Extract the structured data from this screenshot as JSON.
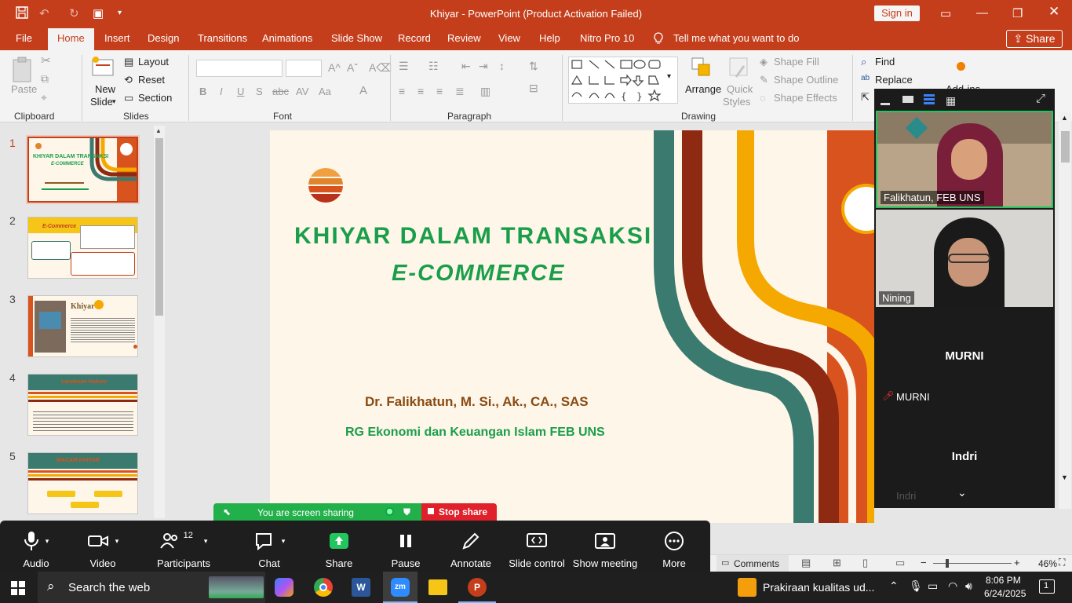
{
  "titlebar": {
    "title": "Khiyar  -  PowerPoint (Product Activation Failed)",
    "signin": "Sign in"
  },
  "tabs": [
    "File",
    "Home",
    "Insert",
    "Design",
    "Transitions",
    "Animations",
    "Slide Show",
    "Record",
    "Review",
    "View",
    "Help",
    "Nitro Pro 10"
  ],
  "tellme": "Tell me what you want to do",
  "share": "Share",
  "ribbon": {
    "paste": "Paste",
    "clipboard": "Clipboard",
    "new_slide_1": "New",
    "new_slide_2": "Slide",
    "layout": "Layout",
    "reset": "Reset",
    "section": "Section",
    "slides": "Slides",
    "font": "Font",
    "paragraph": "Paragraph",
    "drawing": "Drawing",
    "arrange": "Arrange",
    "quick_styles_1": "Quick",
    "quick_styles_2": "Styles",
    "shape_fill": "Shape Fill",
    "shape_outline": "Shape Outline",
    "shape_effects": "Shape Effects",
    "find": "Find",
    "replace": "Replace",
    "addins": "Add-ins"
  },
  "thumbnails": {
    "numbers": [
      "1",
      "2",
      "3",
      "4",
      "5"
    ],
    "t1_title": "KHIYAR DALAM TRANSAKSI",
    "t1_sub": "E-COMMERCE",
    "t2_title": "E-Commerce",
    "t3_title": "Khiyar",
    "t4_title": "Landasan Hukum",
    "t5_title": "MACAM KHIYAR"
  },
  "slide": {
    "title": "KHIYAR DALAM TRANSAKSI",
    "subtitle": "E-COMMERCE",
    "author": "Dr. Falikhatun, M. Si., Ak., CA., SAS",
    "affiliation": "RG Ekonomi dan Keuangan Islam FEB UNS"
  },
  "zoom_panel": {
    "participants": [
      "Falikhatun, FEB UNS",
      "Nining",
      "MURNI",
      "Indri"
    ],
    "murni_label": "MURNI",
    "indri_label": "Indri"
  },
  "share_banner": {
    "text": "You are screen sharing",
    "stop": "Stop share"
  },
  "zoom_toolbar": {
    "audio": "Audio",
    "video": "Video",
    "participants": "Participants",
    "participants_count": "12",
    "chat": "Chat",
    "share": "Share",
    "pause": "Pause",
    "annotate": "Annotate",
    "slide_control": "Slide control",
    "show_meeting": "Show meeting",
    "more": "More"
  },
  "statusbar": {
    "comments": "Comments",
    "zoom": "46%"
  },
  "taskbar": {
    "search": "Search the web",
    "news": "Prakiraan kualitas ud...",
    "time": "8:06 PM",
    "date": "6/24/2025",
    "notif": "1"
  }
}
